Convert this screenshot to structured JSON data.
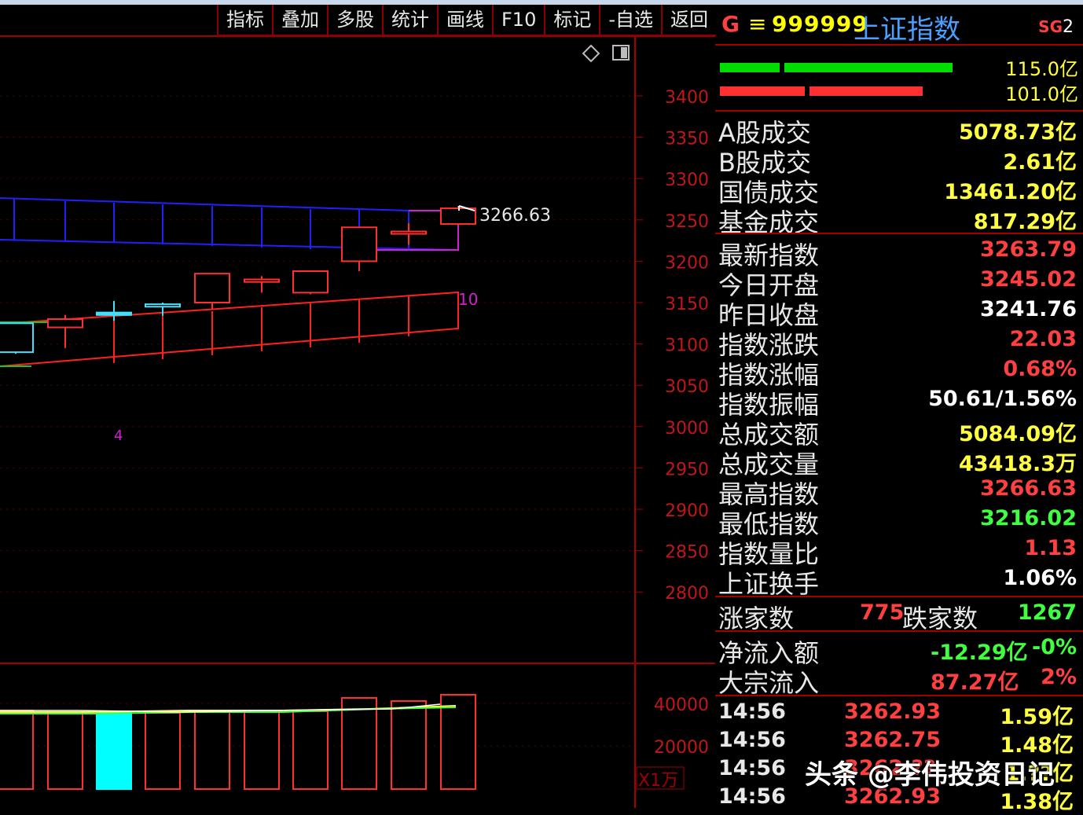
{
  "menu": [
    "指标",
    "叠加",
    "多股",
    "统计",
    "画线",
    "F10",
    "标记",
    "-自选",
    "返回"
  ],
  "header": {
    "g": "G",
    "eq": "≡",
    "code": "999999",
    "name": "上证指数",
    "sg_prefix": "SG",
    "sg_num": "2"
  },
  "flow_bars": [
    {
      "value": "115.0亿",
      "color": "#00dd00"
    },
    {
      "value": "101.0亿",
      "color": "#ff3030"
    }
  ],
  "turnover": [
    {
      "label": "A股成交",
      "value": "5078.73亿",
      "color": "yellow"
    },
    {
      "label": "B股成交",
      "value": "2.61亿",
      "color": "yellow"
    },
    {
      "label": "国债成交",
      "value": "13461.20亿",
      "color": "yellow"
    },
    {
      "label": "基金成交",
      "value": "817.29亿",
      "color": "yellow"
    }
  ],
  "quote": [
    {
      "label": "最新指数",
      "value": "3263.79",
      "color": "red"
    },
    {
      "label": "今日开盘",
      "value": "3245.02",
      "color": "red"
    },
    {
      "label": "昨日收盘",
      "value": "3241.76",
      "color": "white"
    },
    {
      "label": "指数涨跌",
      "value": "22.03",
      "color": "red"
    },
    {
      "label": "指数涨幅",
      "value": "0.68%",
      "color": "red"
    },
    {
      "label": "指数振幅",
      "value": "50.61/1.56%",
      "color": "white"
    },
    {
      "label": "总成交额",
      "value": "5084.09亿",
      "color": "yellow"
    },
    {
      "label": "总成交量",
      "value": "43418.3万",
      "color": "yellow"
    },
    {
      "label": "最高指数",
      "value": "3266.63",
      "color": "red"
    },
    {
      "label": "最低指数",
      "value": "3216.02",
      "color": "green"
    },
    {
      "label": "指数量比",
      "value": "1.13",
      "color": "red"
    },
    {
      "label": "上证换手",
      "value": "1.06%",
      "color": "white"
    }
  ],
  "breadth": {
    "up_label": "涨家数",
    "up_value": "775",
    "down_label": "跌家数",
    "down_value": "1267"
  },
  "flows": [
    {
      "label": "净流入额",
      "value": "-12.29亿",
      "value_color": "green",
      "pct": "-0%",
      "pct_color": "green"
    },
    {
      "label": "大宗流入",
      "value": "87.27亿",
      "value_color": "red",
      "pct": "2%",
      "pct_color": "red"
    }
  ],
  "ticks": [
    {
      "time": "14:56",
      "price": "3262.93",
      "vol": "1.59亿"
    },
    {
      "time": "14:56",
      "price": "3262.75",
      "vol": "1.48亿"
    },
    {
      "time": "14:56",
      "price": "3262.??",
      "vol": "1.??亿"
    },
    {
      "time": "14:56",
      "price": "3262.93",
      "vol": "1.38亿"
    }
  ],
  "watermark": "头条 @李伟投资日记",
  "chart_data": {
    "type": "candlestick",
    "price_axis": [
      "3400",
      "3350",
      "3300",
      "3250",
      "3200",
      "3150",
      "3100",
      "3050",
      "3000",
      "2950",
      "2900",
      "2850",
      "2800"
    ],
    "volume_axis": [
      "40000",
      "20000"
    ],
    "volume_unit": "X1万",
    "high_label": "3266.63",
    "label_10": "10",
    "label_4": "4",
    "candles": [
      {
        "open": 3125,
        "close": 3090,
        "high": 3125,
        "low": 3088
      },
      {
        "open": 3120,
        "close": 3130,
        "high": 3135,
        "low": 3095
      },
      {
        "open": 3135,
        "close": 3138,
        "high": 3152,
        "low": 3128
      },
      {
        "open": 3148,
        "close": 3145,
        "high": 3150,
        "low": 3134
      },
      {
        "open": 3150,
        "close": 3185,
        "high": 3185,
        "low": 3142
      },
      {
        "open": 3175,
        "close": 3178,
        "high": 3182,
        "low": 3162
      },
      {
        "open": 3162,
        "close": 3188,
        "high": 3188,
        "low": 3160
      },
      {
        "open": 3200,
        "close": 3241,
        "high": 3241,
        "low": 3188
      },
      {
        "open": 3234,
        "close": 3236,
        "high": 3246,
        "low": 3220
      },
      {
        "open": 3245,
        "close": 3264,
        "high": 3266.63,
        "low": 3245
      }
    ]
  }
}
